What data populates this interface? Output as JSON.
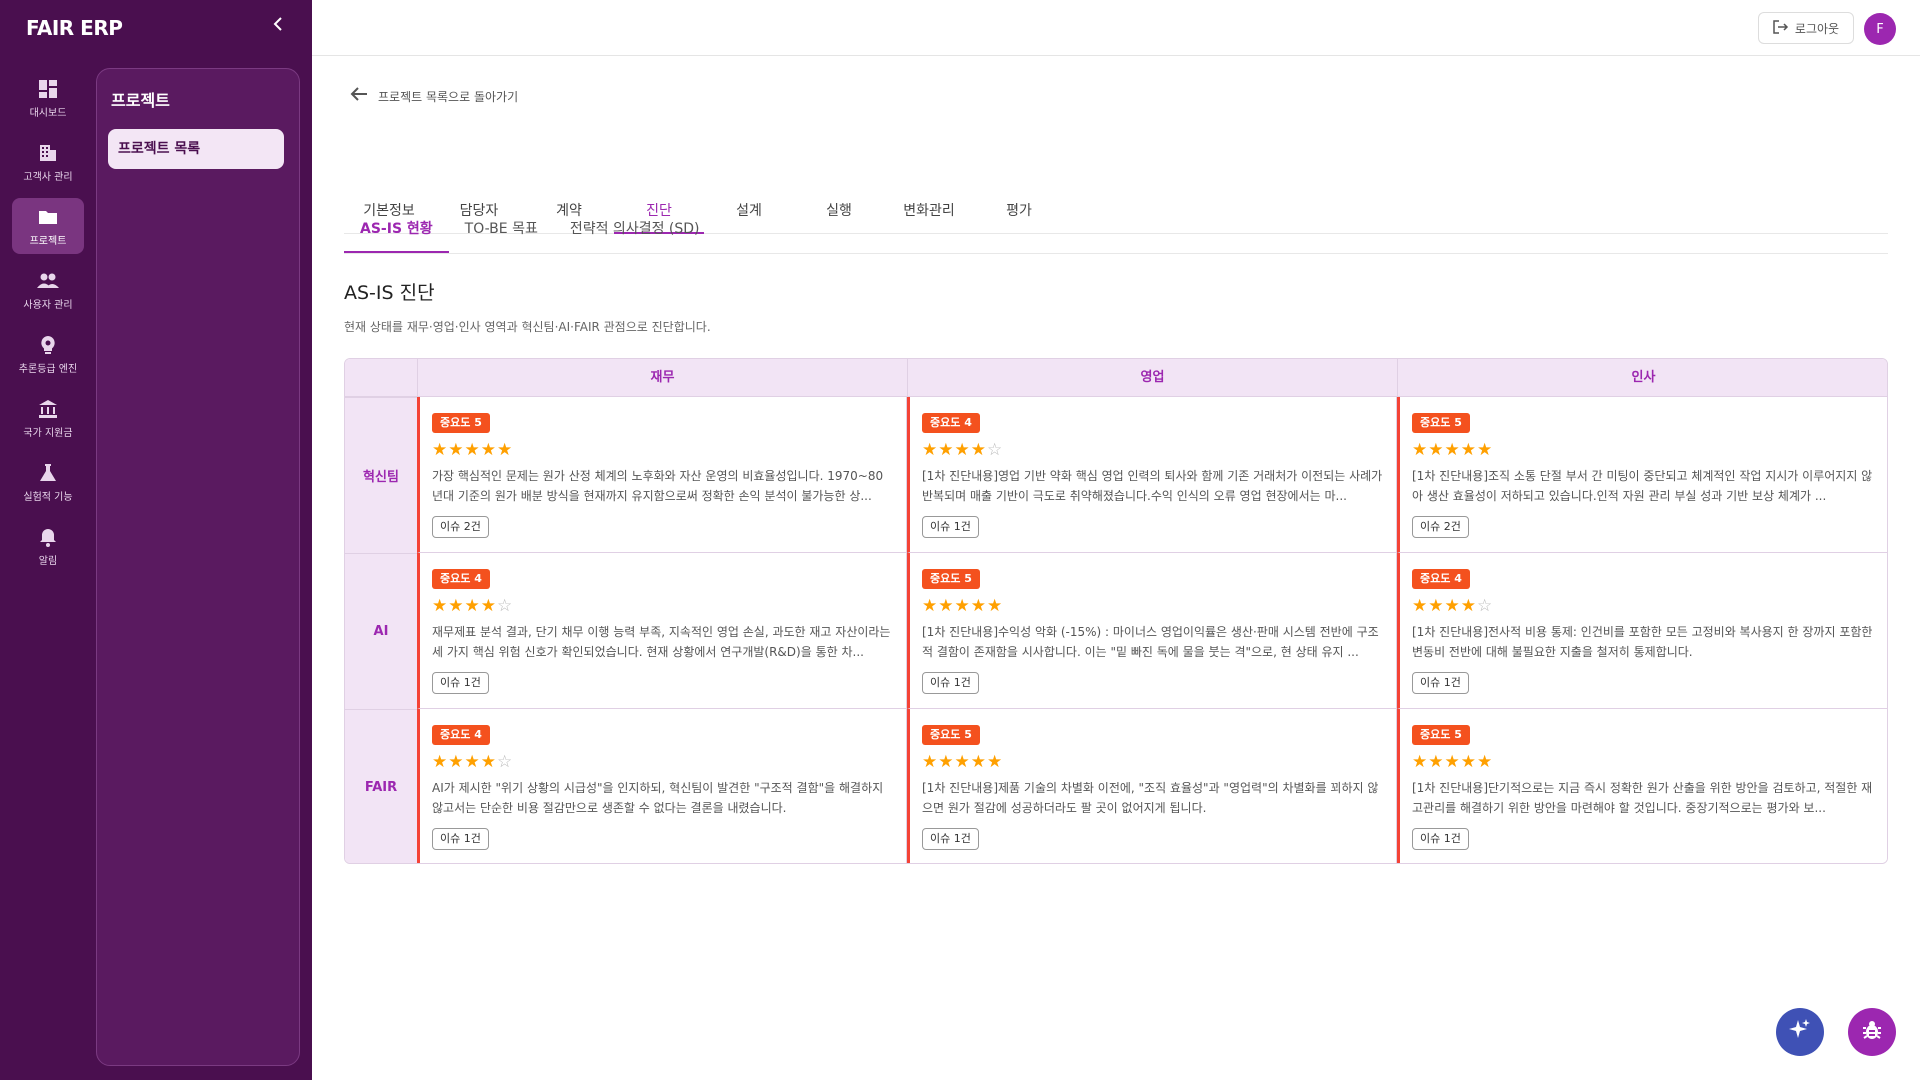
{
  "app": {
    "brand": "FAIR ERP"
  },
  "nav": [
    {
      "label": "대시보드",
      "icon": "dashboard-icon",
      "active": false
    },
    {
      "label": "고객사 관리",
      "icon": "building-icon",
      "active": false
    },
    {
      "label": "프로젝트",
      "icon": "folder-icon",
      "active": true
    },
    {
      "label": "사용자 관리",
      "icon": "people-icon",
      "active": false
    },
    {
      "label": "추론등급 엔진",
      "icon": "brain-icon",
      "active": false
    },
    {
      "label": "국가 지원금",
      "icon": "bank-icon",
      "active": false
    },
    {
      "label": "실험적 기능",
      "icon": "flask-icon",
      "active": false
    },
    {
      "label": "알림",
      "icon": "bell-icon",
      "active": false
    }
  ],
  "subpanel": {
    "title": "프로젝트",
    "item": "프로젝트 목록"
  },
  "topbar": {
    "logout": "로그아웃",
    "avatar": "F"
  },
  "back": "프로젝트 목록으로 돌아가기",
  "tabs": [
    "기본정보",
    "담당자",
    "계약",
    "진단",
    "설계",
    "실행",
    "변화관리",
    "평가"
  ],
  "active_tab": "진단",
  "subtabs": [
    "AS-IS 현황",
    "TO-BE 목표",
    "전략적 의사결정 (SD)"
  ],
  "section": {
    "title": "AS-IS 진단",
    "desc": "현재 상태를 재무·영업·인사 영역과 혁신팀·AI·FAIR 관점으로 진단합니다."
  },
  "grid": {
    "columns": [
      "재무",
      "영업",
      "인사"
    ],
    "rows": [
      {
        "label": "혁신팀",
        "cells": [
          {
            "badge": "중요도 5",
            "rating": 5,
            "desc": "가장 핵심적인 문제는 원가 산정 체계의 노후화와 자산 운영의 비효율성입니다. 1970~80년대 기준의 원가 배분 방식을 현재까지 유지함으로써 정확한 손익 분석이 불가능한 상...",
            "issue": "이슈 2건"
          },
          {
            "badge": "중요도 4",
            "rating": 4,
            "desc": "[1차 진단내용]영업 기반 약화 핵심 영업 인력의 퇴사와 함께 기존 거래처가 이전되는 사례가 반복되며 매출 기반이 극도로 취약해졌습니다.수익 인식의 오류 영업 현장에서는 마...",
            "issue": "이슈 1건"
          },
          {
            "badge": "중요도 5",
            "rating": 5,
            "desc": "[1차 진단내용]조직 소통 단절 부서 간 미팅이 중단되고 체계적인 작업 지시가 이루어지지 않아 생산 효율성이 저하되고 있습니다.인적 자원 관리 부실 성과 기반 보상 체계가 ...",
            "issue": "이슈 2건"
          }
        ]
      },
      {
        "label": "AI",
        "cells": [
          {
            "badge": "중요도 4",
            "rating": 4,
            "desc": "재무제표 분석 결과, 단기 채무 이행 능력 부족, 지속적인 영업 손실, 과도한 재고 자산이라는 세 가지 핵심 위험 신호가 확인되었습니다. 현재 상황에서 연구개발(R&D)을 통한 차...",
            "issue": "이슈 1건"
          },
          {
            "badge": "중요도 5",
            "rating": 5,
            "desc": "[1차 진단내용]수익성 악화 (-15%) : 마이너스 영업이익률은 생산·판매 시스템 전반에 구조적 결함이 존재함을 시사합니다. 이는 \"밑 빠진 독에 물을 붓는 격\"으로, 현 상태 유지 ...",
            "issue": "이슈 1건"
          },
          {
            "badge": "중요도 4",
            "rating": 4,
            "desc": "[1차 진단내용]전사적 비용 통제: 인건비를 포함한 모든 고정비와 복사용지 한 장까지 포함한 변동비 전반에 대해 불필요한 지출을 철저히 통제합니다.",
            "issue": "이슈 1건"
          }
        ]
      },
      {
        "label": "FAIR",
        "cells": [
          {
            "badge": "중요도 4",
            "rating": 4,
            "desc": "AI가 제시한 \"위기 상황의 시급성\"을 인지하되, 혁신팀이 발견한 \"구조적 결함\"을 해결하지 않고서는 단순한 비용 절감만으로 생존할 수 없다는 결론을 내렸습니다.",
            "issue": "이슈 1건"
          },
          {
            "badge": "중요도 5",
            "rating": 5,
            "desc": "[1차 진단내용]제품 기술의 차별화 이전에, \"조직 효율성\"과 \"영업력\"의 차별화를 꾀하지 않으면 원가 절감에 성공하더라도 팔 곳이 없어지게 됩니다.",
            "issue": "이슈 1건"
          },
          {
            "badge": "중요도 5",
            "rating": 5,
            "desc": "[1차 진단내용]단기적으로는 지금 즉시 정확한 원가 산출을 위한 방안을 검토하고, 적절한 재고관리를 해결하기 위한 방안을 마련해야 할 것입니다. 중장기적으로는 평가와 보...",
            "issue": "이슈 1건"
          }
        ]
      }
    ]
  },
  "fabs": {
    "ai": "sparkle-icon",
    "bug": "bug-icon"
  },
  "colors": {
    "primary": "#9c27b0",
    "rail": "#4a0f4f",
    "badge": "#f4511e",
    "cell_border": "#f44336",
    "star": "#ffa000"
  }
}
